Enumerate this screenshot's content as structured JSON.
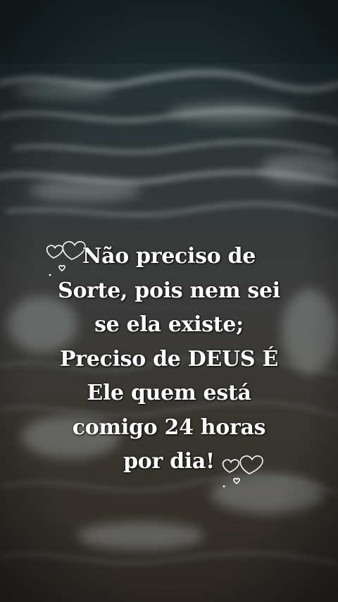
{
  "quote": {
    "lines": [
      "Não preciso de",
      "Sorte, pois nem sei",
      "se ela existe;",
      "Preciso de DEUS É",
      "Ele quem está",
      "comigo 24 horas",
      "por dia!"
    ]
  },
  "background": {
    "scene": "ocean-waves-on-shore",
    "colors": {
      "sea": "#1f2e31",
      "foam": "#8a8f8e",
      "sand": "#3a342e",
      "text": "#ffffff"
    }
  },
  "decorations": {
    "icons": [
      "double-heart-outline-icon",
      "double-heart-outline-icon"
    ]
  }
}
